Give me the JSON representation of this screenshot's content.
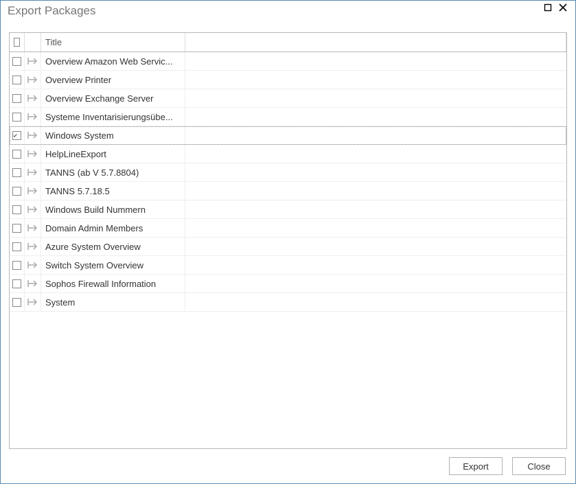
{
  "window": {
    "title": "Export Packages"
  },
  "grid": {
    "header": {
      "title_label": "Title"
    },
    "rows": [
      {
        "checked": false,
        "title": "Overview Amazon Web Servic..."
      },
      {
        "checked": false,
        "title": "Overview Printer"
      },
      {
        "checked": false,
        "title": "Overview Exchange Server"
      },
      {
        "checked": false,
        "title": "Systeme Inventarisierungsübe..."
      },
      {
        "checked": true,
        "title": "Windows System",
        "selected": true
      },
      {
        "checked": false,
        "title": "HelpLineExport"
      },
      {
        "checked": false,
        "title": "TANNS (ab V 5.7.8804)"
      },
      {
        "checked": false,
        "title": "TANNS 5.7.18.5"
      },
      {
        "checked": false,
        "title": "Windows Build Nummern"
      },
      {
        "checked": false,
        "title": "Domain Admin Members"
      },
      {
        "checked": false,
        "title": "Azure System Overview"
      },
      {
        "checked": false,
        "title": "Switch System Overview"
      },
      {
        "checked": false,
        "title": "Sophos Firewall Information"
      },
      {
        "checked": false,
        "title": "System"
      }
    ]
  },
  "footer": {
    "export_label": "Export",
    "close_label": "Close"
  }
}
